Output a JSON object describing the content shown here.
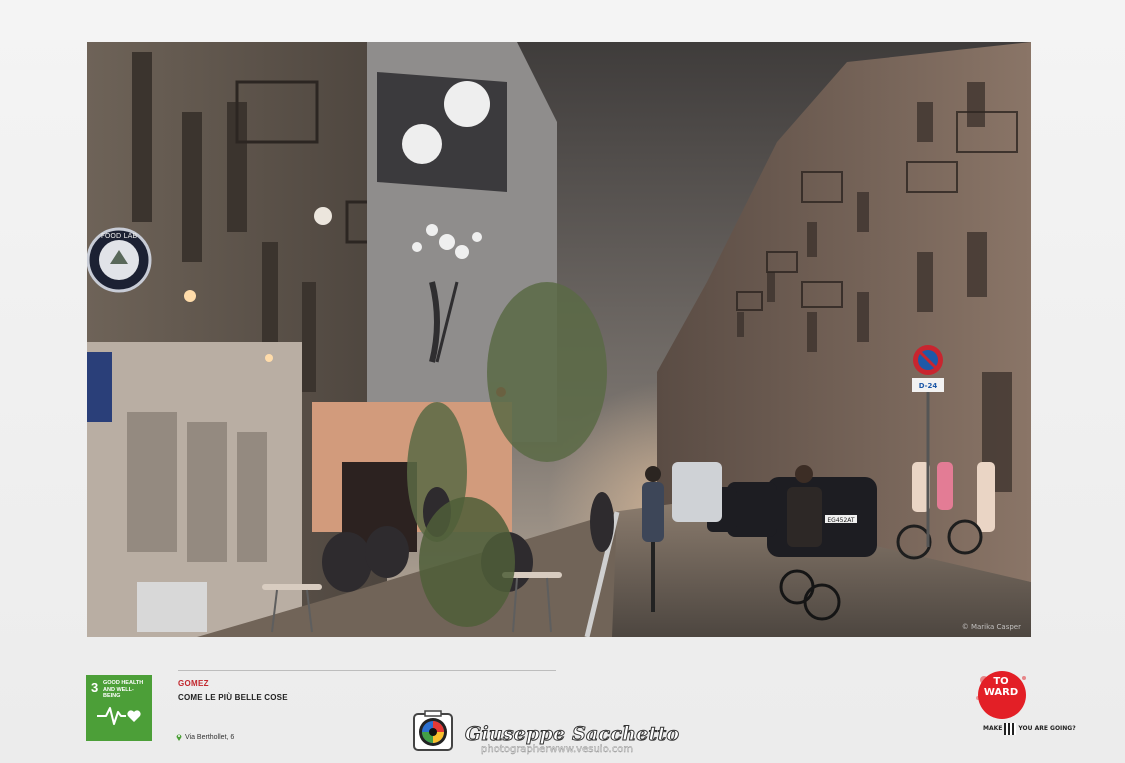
{
  "photo": {
    "credit": "© Marika Casper",
    "sign_text": "FOOD LAB",
    "plate_text": "D-24",
    "car_plate": "EG452AT"
  },
  "sdg": {
    "number": "3",
    "label": "GOOD HEALTH AND WELL-BEING",
    "color": "#4c9f38",
    "icon": "heartbeat-heart-icon"
  },
  "artwork": {
    "artist": "GOMEZ",
    "title": "COME LE PIÙ BELLE COSE",
    "address": "Via Berthollet, 6"
  },
  "watermark": {
    "name": "Giuseppe Sacchetto",
    "url": "photographerwww.vesuio.com"
  },
  "brand": {
    "logo_text": "TO WARD",
    "tagline_left": "MAKE",
    "tagline_right": "YOU ARE GOING?",
    "color": "#e31f26"
  }
}
